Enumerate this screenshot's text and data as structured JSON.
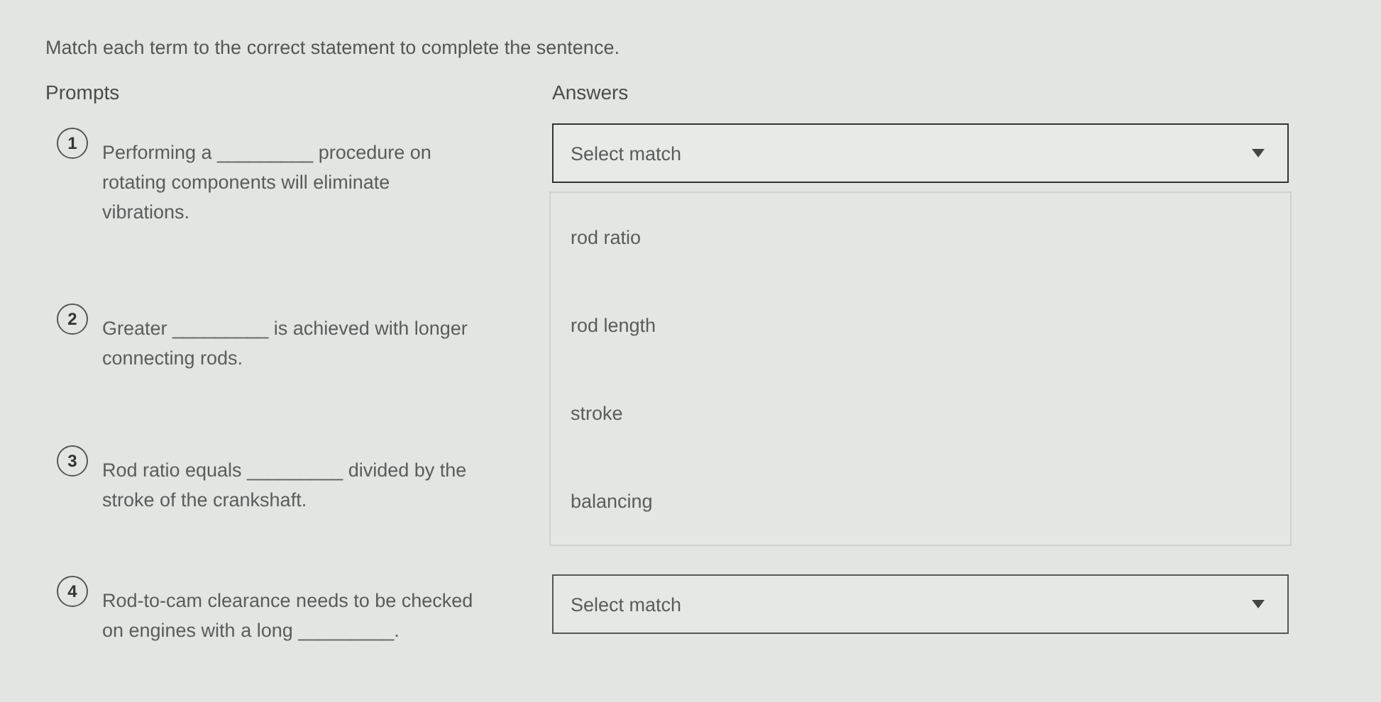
{
  "instructions": "Match each term to the correct statement to complete the sentence.",
  "prompts_heading": "Prompts",
  "answers_heading": "Answers",
  "items": [
    {
      "number": "1",
      "text": "Performing a _________ procedure on rotating components will eliminate vibrations.",
      "answer": {
        "placeholder": "Select match",
        "expanded": true,
        "options": [
          "rod ratio",
          "rod length",
          "stroke",
          "balancing"
        ]
      }
    },
    {
      "number": "2",
      "text": "Greater _________ is achieved with longer connecting rods."
    },
    {
      "number": "3",
      "text": "Rod ratio equals _________ divided by the stroke of the crankshaft."
    },
    {
      "number": "4",
      "text": "Rod-to-cam clearance needs to be checked on engines with a long _________.",
      "answer": {
        "placeholder": "Select match",
        "expanded": false
      }
    }
  ]
}
